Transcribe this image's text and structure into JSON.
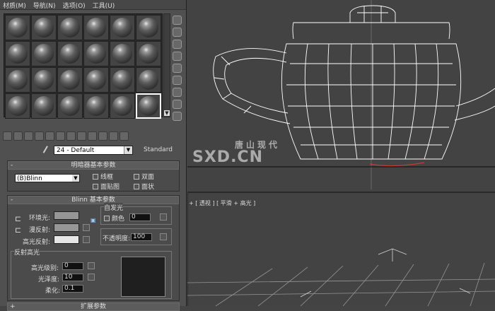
{
  "menu": {
    "items": [
      "材质(M)",
      "导航(N)",
      "选项(O)",
      "工具(U)"
    ]
  },
  "slots": {
    "count": 24,
    "selected_index": 23
  },
  "material": {
    "name": "24 - Default",
    "type": "Standard"
  },
  "shader_basic": {
    "title": "明暗器基本参数",
    "shader": "(B)Blinn",
    "wire": "线框",
    "two_sided": "双面",
    "face_map": "面贴图",
    "faceted": "面状"
  },
  "blinn": {
    "title": "Blinn 基本参数",
    "ambient": "环境光:",
    "diffuse": "漫反射:",
    "specular": "高光反射:",
    "self_illum": "自发光",
    "color": "颜色",
    "self_illum_value": "0",
    "opacity_label": "不透明度:",
    "opacity": "100",
    "highlight_group": "反射高光",
    "spec_level": "高光级别:",
    "spec_level_value": "0",
    "gloss": "光泽度:",
    "gloss_value": "10",
    "soften": "柔化:",
    "soften_value": "0.1",
    "next_rollout": "扩展参数"
  },
  "viewport": {
    "label": "+ [ 透视 ] [ 平滑 + 高光 ]"
  },
  "watermark": {
    "cn": "唐山现代",
    "en": "SXD.CN"
  },
  "colors": {
    "panel": "#505050",
    "viewport": "#434343",
    "ambient": "#969696",
    "diffuse": "#969696",
    "specular": "#e6e6e6",
    "wire": "#ffffff"
  }
}
